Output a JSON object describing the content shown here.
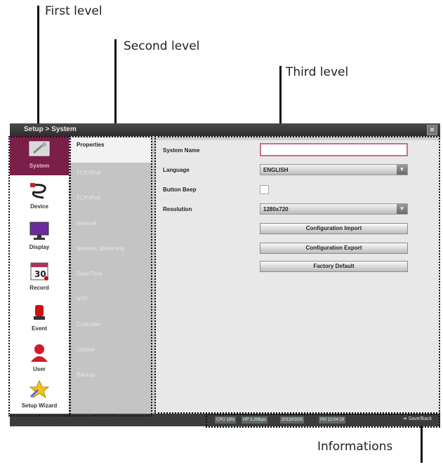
{
  "annotations": {
    "first_level": "First level",
    "second_level": "Second level",
    "third_level": "Third level",
    "informations": "Informations"
  },
  "window": {
    "title": "Setup > System",
    "close_icon": "close-icon"
  },
  "first_level": {
    "items": [
      {
        "label": "System",
        "icon": "system-icon",
        "active": true
      },
      {
        "label": "Device",
        "icon": "device-icon"
      },
      {
        "label": "Display",
        "icon": "display-icon"
      },
      {
        "label": "Record",
        "icon": "record-icon"
      },
      {
        "label": "Event",
        "icon": "event-icon"
      },
      {
        "label": "User",
        "icon": "user-icon"
      },
      {
        "label": "Setup Wizard",
        "icon": "setup-wizard-icon"
      }
    ]
  },
  "second_level": {
    "items": [
      {
        "label": "Properties",
        "active": true
      },
      {
        "label": "TCP/IPv4"
      },
      {
        "label": "TCP/IPv6"
      },
      {
        "label": "Network"
      },
      {
        "label": "Network Streaming"
      },
      {
        "label": "Date/Time"
      },
      {
        "label": "NTP"
      },
      {
        "label": "Controller"
      },
      {
        "label": "Update"
      },
      {
        "label": "Backup"
      }
    ]
  },
  "third_level": {
    "system_name_label": "System Name",
    "system_name_value": "",
    "language_label": "Language",
    "language_value": "ENGLISH",
    "button_beep_label": "Button Beep",
    "resolution_label": "Resolution",
    "resolution_value": "1280x720",
    "config_import": "Configuration Import",
    "config_export": "Configuration Export",
    "factory_default": "Factory Default"
  },
  "statusbar": {
    "cpu": "CPU 18%",
    "hdd": "HP 3.2Mbps",
    "date": "2013/03/05",
    "time": "PM 12:04:19",
    "back": "Save/Back"
  },
  "colors": {
    "accent": "#7a1e4a",
    "highlight_border": "#c77090"
  }
}
